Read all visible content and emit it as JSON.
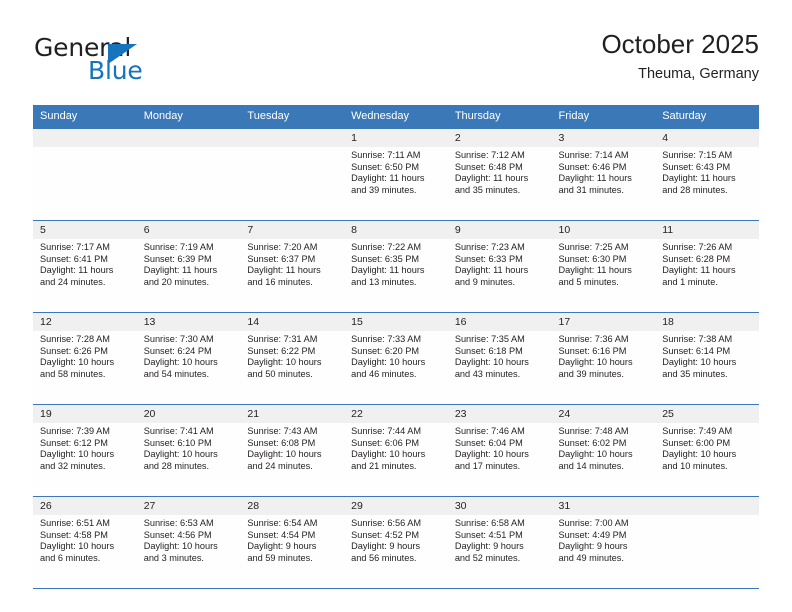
{
  "brand": {
    "name_part1": "General",
    "name_part2": "Blue",
    "triangle_color": "#1574bb"
  },
  "header": {
    "title": "October 2025",
    "subtitle": "Theuma, Germany"
  },
  "theme": {
    "header_bg": "#3b78b8",
    "header_text": "#ffffff",
    "daynum_bg": "#f0f0f0",
    "cell_bg": "#fefefe",
    "rule_color": "#3b78b8",
    "text": "#231f20"
  },
  "weekdays": [
    "Sunday",
    "Monday",
    "Tuesday",
    "Wednesday",
    "Thursday",
    "Friday",
    "Saturday"
  ],
  "weeks": [
    {
      "days": [
        {
          "num": "",
          "sunrise": "",
          "sunset": "",
          "daylight1": "",
          "daylight2": ""
        },
        {
          "num": "",
          "sunrise": "",
          "sunset": "",
          "daylight1": "",
          "daylight2": ""
        },
        {
          "num": "",
          "sunrise": "",
          "sunset": "",
          "daylight1": "",
          "daylight2": ""
        },
        {
          "num": "1",
          "sunrise": "Sunrise: 7:11 AM",
          "sunset": "Sunset: 6:50 PM",
          "daylight1": "Daylight: 11 hours",
          "daylight2": "and 39 minutes."
        },
        {
          "num": "2",
          "sunrise": "Sunrise: 7:12 AM",
          "sunset": "Sunset: 6:48 PM",
          "daylight1": "Daylight: 11 hours",
          "daylight2": "and 35 minutes."
        },
        {
          "num": "3",
          "sunrise": "Sunrise: 7:14 AM",
          "sunset": "Sunset: 6:46 PM",
          "daylight1": "Daylight: 11 hours",
          "daylight2": "and 31 minutes."
        },
        {
          "num": "4",
          "sunrise": "Sunrise: 7:15 AM",
          "sunset": "Sunset: 6:43 PM",
          "daylight1": "Daylight: 11 hours",
          "daylight2": "and 28 minutes."
        }
      ]
    },
    {
      "days": [
        {
          "num": "5",
          "sunrise": "Sunrise: 7:17 AM",
          "sunset": "Sunset: 6:41 PM",
          "daylight1": "Daylight: 11 hours",
          "daylight2": "and 24 minutes."
        },
        {
          "num": "6",
          "sunrise": "Sunrise: 7:19 AM",
          "sunset": "Sunset: 6:39 PM",
          "daylight1": "Daylight: 11 hours",
          "daylight2": "and 20 minutes."
        },
        {
          "num": "7",
          "sunrise": "Sunrise: 7:20 AM",
          "sunset": "Sunset: 6:37 PM",
          "daylight1": "Daylight: 11 hours",
          "daylight2": "and 16 minutes."
        },
        {
          "num": "8",
          "sunrise": "Sunrise: 7:22 AM",
          "sunset": "Sunset: 6:35 PM",
          "daylight1": "Daylight: 11 hours",
          "daylight2": "and 13 minutes."
        },
        {
          "num": "9",
          "sunrise": "Sunrise: 7:23 AM",
          "sunset": "Sunset: 6:33 PM",
          "daylight1": "Daylight: 11 hours",
          "daylight2": "and 9 minutes."
        },
        {
          "num": "10",
          "sunrise": "Sunrise: 7:25 AM",
          "sunset": "Sunset: 6:30 PM",
          "daylight1": "Daylight: 11 hours",
          "daylight2": "and 5 minutes."
        },
        {
          "num": "11",
          "sunrise": "Sunrise: 7:26 AM",
          "sunset": "Sunset: 6:28 PM",
          "daylight1": "Daylight: 11 hours",
          "daylight2": "and 1 minute."
        }
      ]
    },
    {
      "days": [
        {
          "num": "12",
          "sunrise": "Sunrise: 7:28 AM",
          "sunset": "Sunset: 6:26 PM",
          "daylight1": "Daylight: 10 hours",
          "daylight2": "and 58 minutes."
        },
        {
          "num": "13",
          "sunrise": "Sunrise: 7:30 AM",
          "sunset": "Sunset: 6:24 PM",
          "daylight1": "Daylight: 10 hours",
          "daylight2": "and 54 minutes."
        },
        {
          "num": "14",
          "sunrise": "Sunrise: 7:31 AM",
          "sunset": "Sunset: 6:22 PM",
          "daylight1": "Daylight: 10 hours",
          "daylight2": "and 50 minutes."
        },
        {
          "num": "15",
          "sunrise": "Sunrise: 7:33 AM",
          "sunset": "Sunset: 6:20 PM",
          "daylight1": "Daylight: 10 hours",
          "daylight2": "and 46 minutes."
        },
        {
          "num": "16",
          "sunrise": "Sunrise: 7:35 AM",
          "sunset": "Sunset: 6:18 PM",
          "daylight1": "Daylight: 10 hours",
          "daylight2": "and 43 minutes."
        },
        {
          "num": "17",
          "sunrise": "Sunrise: 7:36 AM",
          "sunset": "Sunset: 6:16 PM",
          "daylight1": "Daylight: 10 hours",
          "daylight2": "and 39 minutes."
        },
        {
          "num": "18",
          "sunrise": "Sunrise: 7:38 AM",
          "sunset": "Sunset: 6:14 PM",
          "daylight1": "Daylight: 10 hours",
          "daylight2": "and 35 minutes."
        }
      ]
    },
    {
      "days": [
        {
          "num": "19",
          "sunrise": "Sunrise: 7:39 AM",
          "sunset": "Sunset: 6:12 PM",
          "daylight1": "Daylight: 10 hours",
          "daylight2": "and 32 minutes."
        },
        {
          "num": "20",
          "sunrise": "Sunrise: 7:41 AM",
          "sunset": "Sunset: 6:10 PM",
          "daylight1": "Daylight: 10 hours",
          "daylight2": "and 28 minutes."
        },
        {
          "num": "21",
          "sunrise": "Sunrise: 7:43 AM",
          "sunset": "Sunset: 6:08 PM",
          "daylight1": "Daylight: 10 hours",
          "daylight2": "and 24 minutes."
        },
        {
          "num": "22",
          "sunrise": "Sunrise: 7:44 AM",
          "sunset": "Sunset: 6:06 PM",
          "daylight1": "Daylight: 10 hours",
          "daylight2": "and 21 minutes."
        },
        {
          "num": "23",
          "sunrise": "Sunrise: 7:46 AM",
          "sunset": "Sunset: 6:04 PM",
          "daylight1": "Daylight: 10 hours",
          "daylight2": "and 17 minutes."
        },
        {
          "num": "24",
          "sunrise": "Sunrise: 7:48 AM",
          "sunset": "Sunset: 6:02 PM",
          "daylight1": "Daylight: 10 hours",
          "daylight2": "and 14 minutes."
        },
        {
          "num": "25",
          "sunrise": "Sunrise: 7:49 AM",
          "sunset": "Sunset: 6:00 PM",
          "daylight1": "Daylight: 10 hours",
          "daylight2": "and 10 minutes."
        }
      ]
    },
    {
      "days": [
        {
          "num": "26",
          "sunrise": "Sunrise: 6:51 AM",
          "sunset": "Sunset: 4:58 PM",
          "daylight1": "Daylight: 10 hours",
          "daylight2": "and 6 minutes."
        },
        {
          "num": "27",
          "sunrise": "Sunrise: 6:53 AM",
          "sunset": "Sunset: 4:56 PM",
          "daylight1": "Daylight: 10 hours",
          "daylight2": "and 3 minutes."
        },
        {
          "num": "28",
          "sunrise": "Sunrise: 6:54 AM",
          "sunset": "Sunset: 4:54 PM",
          "daylight1": "Daylight: 9 hours",
          "daylight2": "and 59 minutes."
        },
        {
          "num": "29",
          "sunrise": "Sunrise: 6:56 AM",
          "sunset": "Sunset: 4:52 PM",
          "daylight1": "Daylight: 9 hours",
          "daylight2": "and 56 minutes."
        },
        {
          "num": "30",
          "sunrise": "Sunrise: 6:58 AM",
          "sunset": "Sunset: 4:51 PM",
          "daylight1": "Daylight: 9 hours",
          "daylight2": "and 52 minutes."
        },
        {
          "num": "31",
          "sunrise": "Sunrise: 7:00 AM",
          "sunset": "Sunset: 4:49 PM",
          "daylight1": "Daylight: 9 hours",
          "daylight2": "and 49 minutes."
        },
        {
          "num": "",
          "sunrise": "",
          "sunset": "",
          "daylight1": "",
          "daylight2": ""
        }
      ]
    }
  ]
}
